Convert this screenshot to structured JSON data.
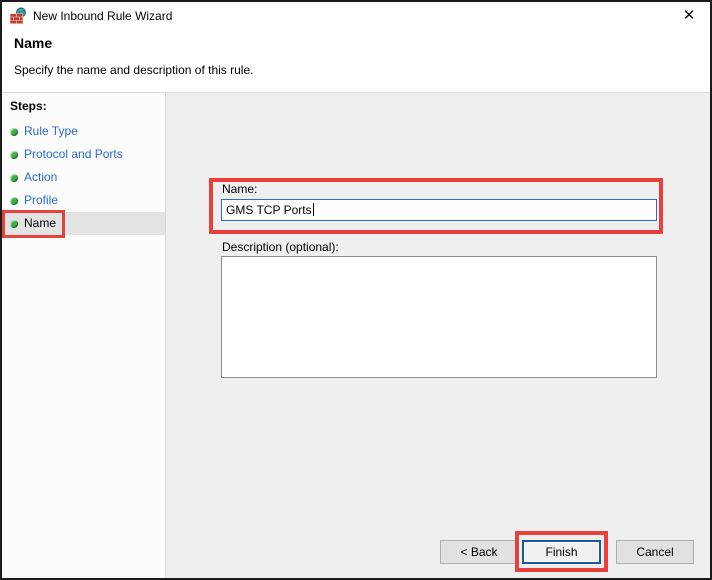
{
  "window": {
    "title": "New Inbound Rule Wizard",
    "close_glyph": "✕"
  },
  "header": {
    "title": "Name",
    "subtitle": "Specify the name and description of this rule."
  },
  "sidebar": {
    "heading": "Steps:",
    "items": [
      {
        "label": "Rule Type"
      },
      {
        "label": "Protocol and Ports"
      },
      {
        "label": "Action"
      },
      {
        "label": "Profile"
      },
      {
        "label": "Name"
      }
    ],
    "selected": "Name"
  },
  "form": {
    "name_label": "Name:",
    "name_value": "GMS TCP Ports",
    "description_label": "Description (optional):",
    "description_value": ""
  },
  "buttons": {
    "back": "< Back",
    "finish": "Finish",
    "cancel": "Cancel"
  },
  "colors": {
    "annotation": "#e8403a",
    "accent": "#19599f",
    "link": "#2a6ad4",
    "bullet": "#3fae49",
    "focus": "#2b6cc4"
  }
}
